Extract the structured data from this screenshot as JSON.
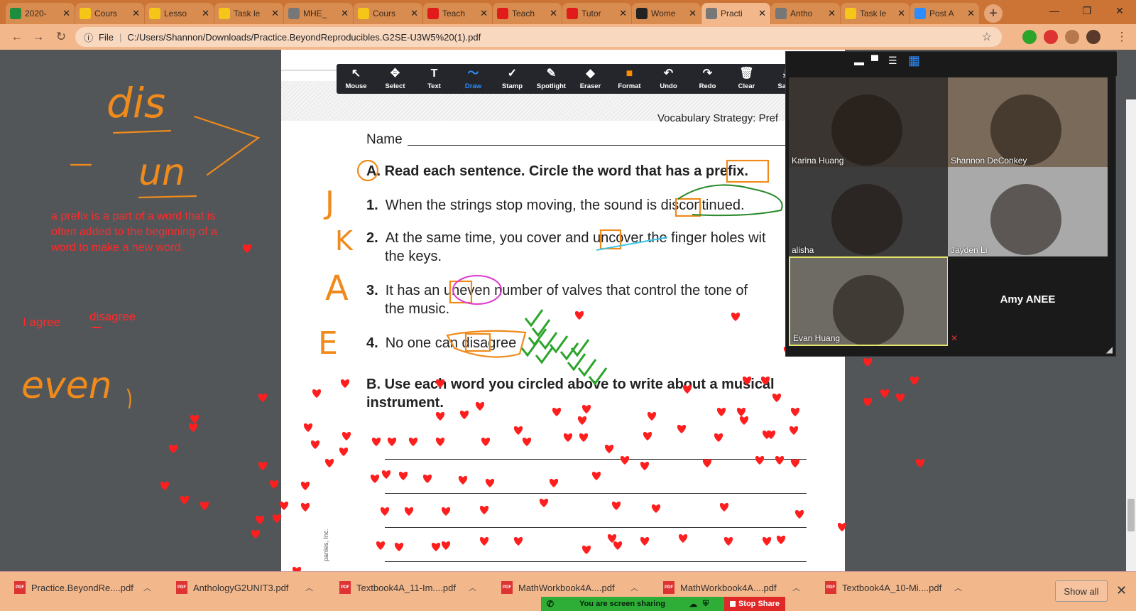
{
  "browser": {
    "tabs": [
      {
        "title": "2020-",
        "icon": "sheets-icon",
        "color": "#1e8e3e"
      },
      {
        "title": "Cours",
        "icon": "classroom-icon",
        "color": "#f5c518"
      },
      {
        "title": "Lesso",
        "icon": "classroom-icon",
        "color": "#f5c518"
      },
      {
        "title": "Task le",
        "icon": "classroom-icon",
        "color": "#f5c518"
      },
      {
        "title": "MHE_",
        "icon": "globe-icon",
        "color": "#777777"
      },
      {
        "title": "Cours",
        "icon": "classroom-icon",
        "color": "#f5c518"
      },
      {
        "title": "Teach",
        "icon": "i-icon",
        "color": "#e11a1a"
      },
      {
        "title": "Teach",
        "icon": "i-icon",
        "color": "#e11a1a"
      },
      {
        "title": "Tutor",
        "icon": "i-icon",
        "color": "#e11a1a"
      },
      {
        "title": "Wome",
        "icon": "ae-icon",
        "color": "#222222"
      },
      {
        "title": "Practi",
        "icon": "globe-icon",
        "color": "#777777",
        "active": true
      },
      {
        "title": "Antho",
        "icon": "globe-icon",
        "color": "#777777"
      },
      {
        "title": "Task le",
        "icon": "classroom-icon",
        "color": "#f5c518"
      },
      {
        "title": "Post A",
        "icon": "zoom-icon",
        "color": "#2d8cff"
      }
    ],
    "address": {
      "scheme_label": "File",
      "url": "C:/Users/Shannon/Downloads/Practice.BeyondReproducibles.G2SE-U3W5%20(1).pdf"
    }
  },
  "annotation_toolbar": {
    "tools": [
      {
        "label": "Mouse",
        "icon": "mouse-pointer-icon",
        "glyph": "↖"
      },
      {
        "label": "Select",
        "icon": "move-icon",
        "glyph": "✥"
      },
      {
        "label": "Text",
        "icon": "text-icon",
        "glyph": "T"
      },
      {
        "label": "Draw",
        "icon": "draw-icon",
        "glyph": "〜",
        "active": true
      },
      {
        "label": "Stamp",
        "icon": "stamp-icon",
        "glyph": "✓"
      },
      {
        "label": "Spotlight",
        "icon": "spotlight-icon",
        "glyph": "✎"
      },
      {
        "label": "Eraser",
        "icon": "eraser-icon",
        "glyph": "◆"
      },
      {
        "label": "Format",
        "icon": "format-icon",
        "glyph": "■"
      },
      {
        "label": "Undo",
        "icon": "undo-icon",
        "glyph": "↶"
      },
      {
        "label": "Redo",
        "icon": "redo-icon",
        "glyph": "↷"
      },
      {
        "label": "Clear",
        "icon": "trash-icon",
        "glyph": "🗑"
      },
      {
        "label": "Save",
        "icon": "save-icon",
        "glyph": "⤓"
      }
    ]
  },
  "worksheet": {
    "header": "Vocabulary Strategy: Pref",
    "name_label": "Name",
    "section_a": "Read each sentence. Circle the word that has a prefix.",
    "section_a_marker": "A.",
    "items": [
      {
        "num": "1.",
        "text": "When the strings stop moving, the sound is discontinued."
      },
      {
        "num": "2.",
        "text": "At the same time, you cover and uncover the finger holes wit",
        "cont": "the keys."
      },
      {
        "num": "3.",
        "text": "It has an uneven number of valves that control the tone of",
        "cont": "the music."
      },
      {
        "num": "4.",
        "text": "No one can disagree"
      }
    ],
    "section_b_marker": "B.",
    "section_b": "Use each word you circled above to write about a musical",
    "section_b_cont": "instrument.",
    "copyright_fragment": "panies, Inc."
  },
  "ink": {
    "dis": "dis",
    "un": "un",
    "even": "even",
    "prefix_note": "a prefix is a part of a word that is often added to the beginning of a word to make a new word.",
    "agree": "I agree",
    "disagree": "disagree",
    "letters": [
      "J",
      "K",
      "A",
      "E"
    ],
    "orange": "#ef8a1b",
    "red": "#ff2a2a",
    "green": "#2aa52a"
  },
  "zoom": {
    "participants": [
      {
        "name": "Karina Huang"
      },
      {
        "name": "Shannon DeConkey"
      },
      {
        "name": "alisha"
      },
      {
        "name": "Jayden Li"
      },
      {
        "name": "Evan Huang",
        "active_speaker": true
      },
      {
        "name": "Amy ANEE"
      }
    ]
  },
  "downloads": {
    "items": [
      {
        "name": "Practice.BeyondRe....pdf"
      },
      {
        "name": "AnthologyG2UNIT3.pdf"
      },
      {
        "name": "Textbook4A_11-Im....pdf"
      },
      {
        "name": "MathWorkbook4A....pdf"
      },
      {
        "name": "MathWorkbook4A....pdf"
      },
      {
        "name": "Textbook4A_10-Mi....pdf"
      }
    ],
    "show_all": "Show all"
  },
  "screen_share": {
    "status": "You are screen sharing",
    "stop_label": "Stop Share"
  }
}
